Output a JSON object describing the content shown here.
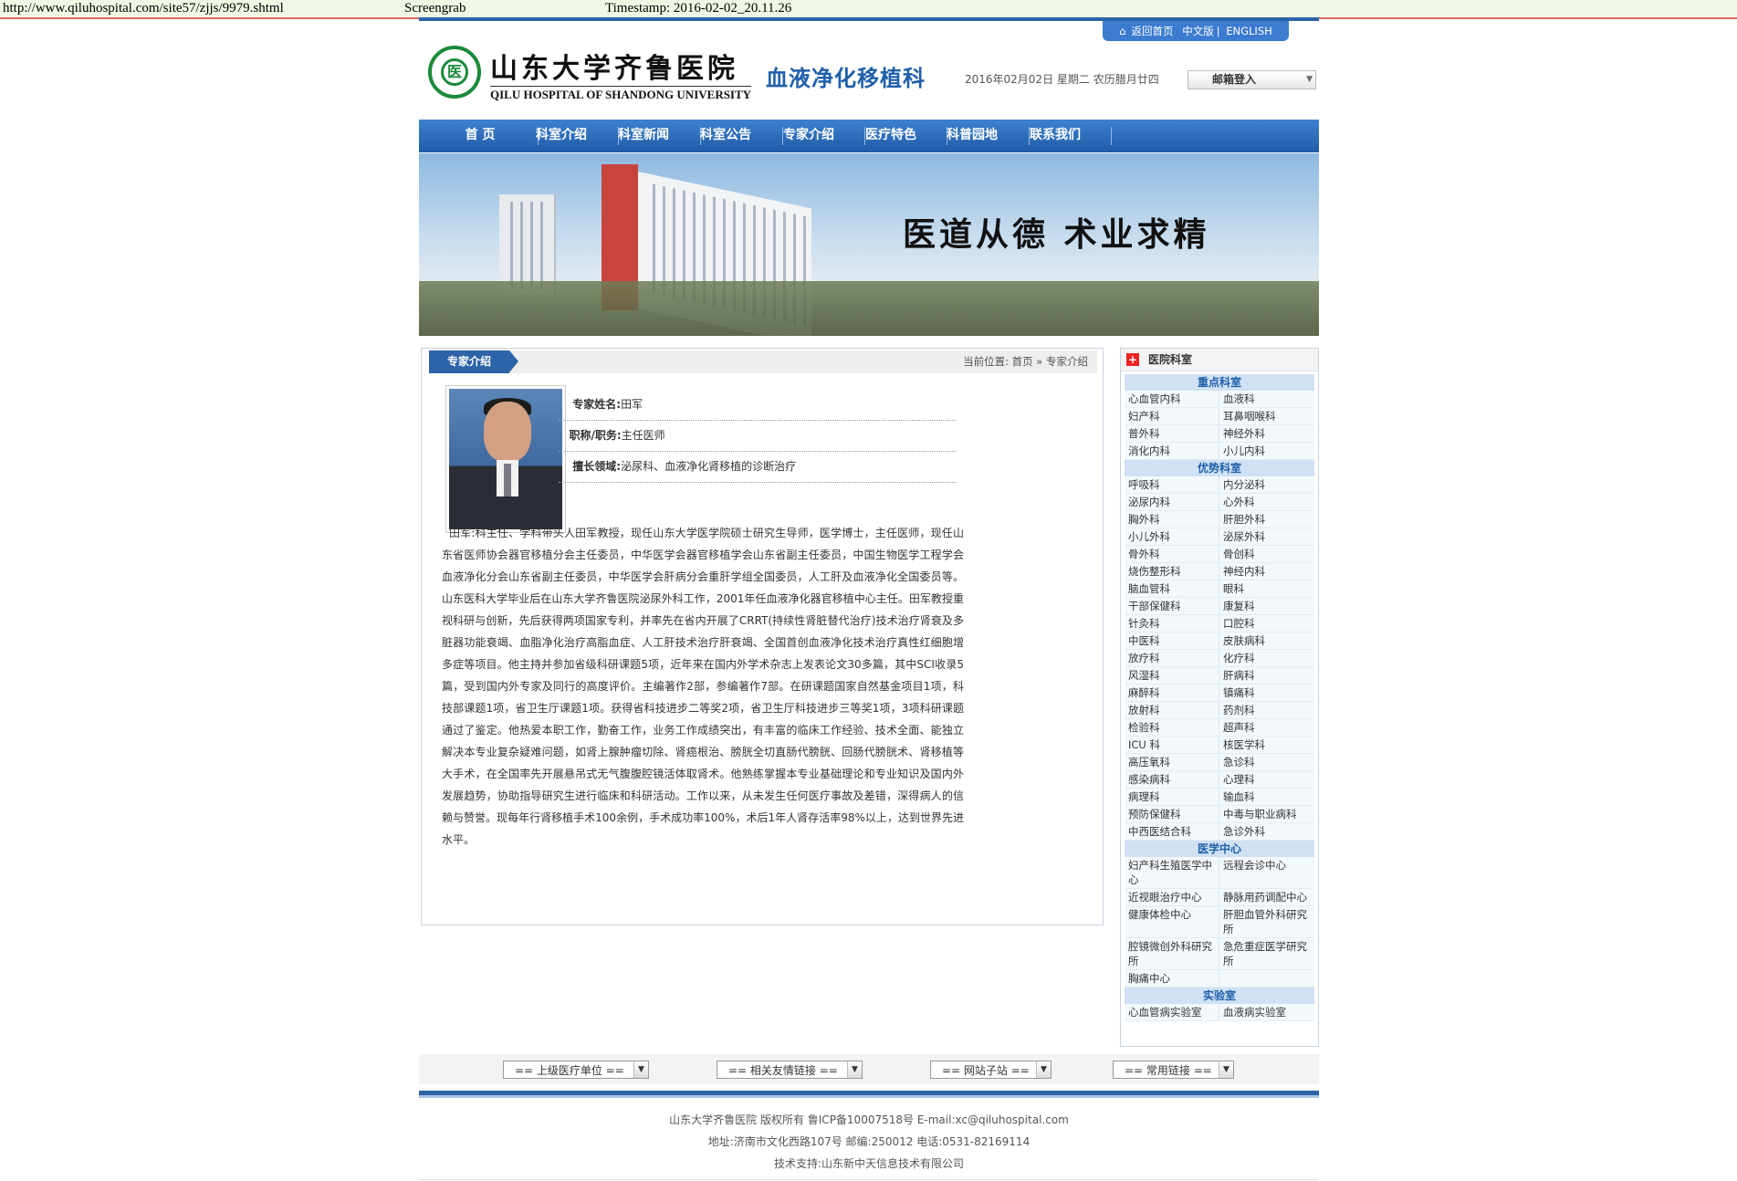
{
  "wayback": {
    "url": "http://www.qiluhospital.com/site57/zjjs/9979.shtml",
    "label": "Screengrab",
    "timestamp": "Timestamp: 2016-02-02_20.11.26"
  },
  "header": {
    "links": [
      "返回首页",
      "中文版",
      "ENGLISH"
    ],
    "logo_cn": "山东大学齐鲁医院",
    "logo_en": "QILU HOSPITAL OF SHANDONG UNIVERSITY",
    "dept": "血液净化移植科",
    "date": "2016年02月02日 星期二 农历腊月廿四",
    "mail_button": "邮箱登入"
  },
  "nav": [
    "首 页",
    "科室介绍",
    "科室新闻",
    "科室公告",
    "专家介绍",
    "医疗特色",
    "科普园地",
    "联系我们"
  ],
  "banner": {
    "slogan": "医道从德  术业求精"
  },
  "main": {
    "tab": "专家介绍",
    "breadcrumb": "当前位置: 首页 » 专家介绍",
    "info": [
      {
        "label": "专家姓名:",
        "value": "田军"
      },
      {
        "label": "职称/职务:",
        "value": "主任医师"
      },
      {
        "label": "擅长领域:",
        "value": "泌尿科、血液净化肾移植的诊断治疗"
      }
    ],
    "bio": "田军:科主任、学科带头人田军教授，现任山东大学医学院硕士研究生导师，医学博士，主任医师，现任山东省医师协会器官移植分会主任委员，中华医学会器官移植学会山东省副主任委员，中国生物医学工程学会血液净化分会山东省副主任委员，中华医学会肝病分会重肝学组全国委员，人工肝及血液净化全国委员等。山东医科大学毕业后在山东大学齐鲁医院泌尿外科工作，2001年任血液净化器官移植中心主任。田军教授重视科研与创新，先后获得两项国家专利，并率先在省内开展了CRRT(持续性肾脏替代治疗)技术治疗肾衰及多脏器功能衰竭、血脂净化治疗高脂血症、人工肝技术治疗肝衰竭、全国首创血液净化技术治疗真性红细胞增多症等项目。他主持并参加省级科研课题5项，近年来在国内外学术杂志上发表论文30多篇，其中SCI收录5篇，受到国内外专家及同行的高度评价。主编著作2部，参编著作7部。在研课题国家自然基金项目1项，科技部课题1项，省卫生厅课题1项。获得省科技进步二等奖2项，省卫生厅科技进步三等奖1项，3项科研课题通过了鉴定。他热爱本职工作，勤奋工作，业务工作成绩突出，有丰富的临床工作经验、技术全面、能独立解决本专业复杂疑难问题，如肾上腺肿瘤切除、肾癌根治、膀胱全切直肠代膀胱、回肠代膀胱术、肾移植等大手术，在全国率先开展悬吊式无气腹腹腔镜活体取肾术。他熟练掌握本专业基础理论和专业知识及国内外发展趋势，协助指导研究生进行临床和科研活动。工作以来，从未发生任何医疗事故及差错，深得病人的信赖与赞誉。现每年行肾移植手术100余例，手术成功率100%，术后1年人肾存活率98%以上，达到世界先进水平。"
  },
  "sidebar": {
    "title": "医院科室",
    "sections": [
      {
        "title": "重点科室",
        "items": [
          "心血管内科",
          "血液科",
          "妇产科",
          "耳鼻咽喉科",
          "普外科",
          "神经外科",
          "消化内科",
          "小儿内科"
        ]
      },
      {
        "title": "优势科室",
        "items": [
          "呼吸科",
          "内分泌科",
          "泌尿内科",
          "心外科",
          "胸外科",
          "肝胆外科",
          "小儿外科",
          "泌尿外科",
          "骨外科",
          "骨创科",
          "烧伤整形科",
          "神经内科",
          "脑血管科",
          "眼科",
          "干部保健科",
          "康复科",
          "针灸科",
          "口腔科",
          "中医科",
          "皮肤病科",
          "放疗科",
          "化疗科",
          "风湿科",
          "肝病科",
          "麻醉科",
          "镇痛科",
          "放射科",
          "药剂科",
          "检验科",
          "超声科",
          "ICU 科",
          "核医学科",
          "高压氧科",
          "急诊科",
          "感染病科",
          "心理科",
          "病理科",
          "输血科",
          "预防保健科",
          "中毒与职业病科",
          "中西医结合科",
          "急诊外科"
        ]
      },
      {
        "title": "医学中心",
        "items": [
          "妇产科生殖医学中心",
          "远程会诊中心",
          "近视眼治疗中心",
          "静脉用药调配中心",
          "健康体检中心",
          "肝胆血管外科研究所",
          "腔镜微创外科研究所",
          "急危重症医学研究所",
          "胸痛中心",
          ""
        ]
      },
      {
        "title": "实验室",
        "items": [
          "心血管病实验室",
          "血液病实验室"
        ]
      }
    ]
  },
  "footer": {
    "selects": [
      "== 上级医疗单位 ==",
      "== 相关友情链接 ==",
      "== 网站子站 ==",
      "== 常用链接 =="
    ],
    "line1": "山东大学齐鲁医院 版权所有 鲁ICP备10007518号    E-mail:xc@qiluhospital.com",
    "line2": "地址:济南市文化西路107号     邮编:250012    电话:0531-82169114",
    "line3": "技术支持:山东新中天信息技术有限公司"
  }
}
